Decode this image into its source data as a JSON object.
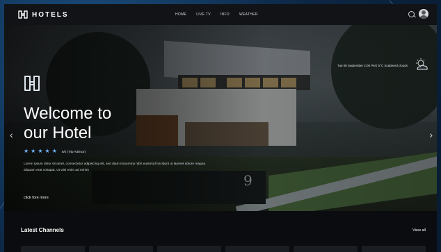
{
  "header": {
    "logo_text": "HOTELS",
    "nav": [
      "HOME",
      "LIVE TV",
      "INFO",
      "WEATHER"
    ]
  },
  "hero": {
    "weather_text": "Tue 08 September 2:00 PM | 5°C Scattered clouds",
    "title_line1": "Welcome to",
    "title_line2": "our Hotel",
    "stars": 5,
    "rating_text": "5/5 (Trip Advisor)",
    "description": "Lorem ipsum dolor sit amet, consectetur adipiscing elit, sed diam nonummy nibh euismod tincidunt ut laoreet dolore magna aliquam erat volutpat. Ut wisi enim ad minim",
    "cta": "click fore more",
    "house_number": "9"
  },
  "channels": {
    "title": "Latest Channels",
    "view_all": "View all",
    "cards": 6
  },
  "colors": {
    "accent": "#6fb6ff",
    "header_bg": "#111316",
    "page_bg": "#0b0c0f",
    "frame_bg": "#0c2745"
  },
  "icons": {
    "arrow_left": "chevron-left-icon",
    "arrow_right": "chevron-right-icon",
    "search": "search-icon",
    "user": "avatar",
    "weather": "partly-cloudy-icon",
    "logo": "hotel-logo-icon"
  }
}
